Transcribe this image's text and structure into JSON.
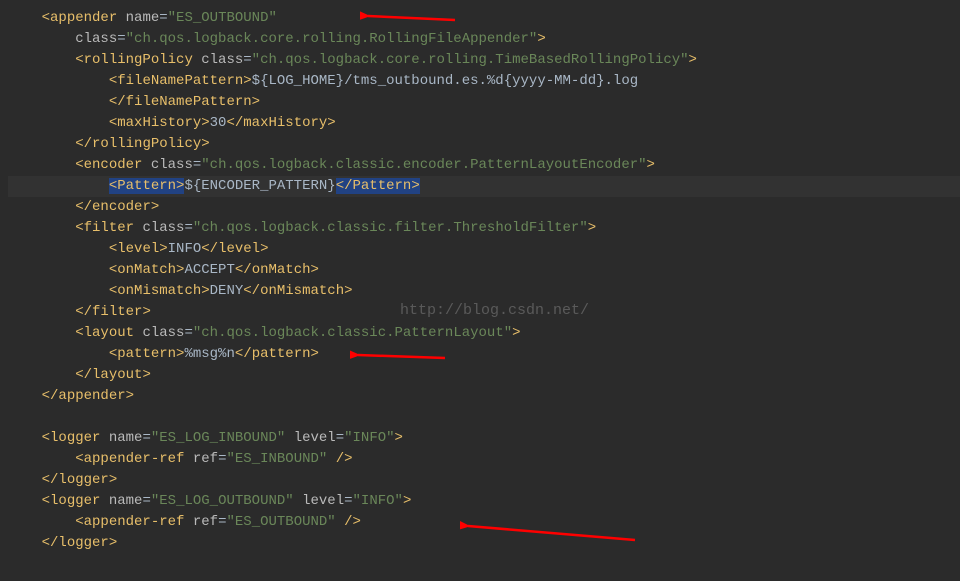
{
  "code": {
    "l1": {
      "indent": "    ",
      "tag": "appender",
      "attr": "name",
      "val": "\"ES_OUTBOUND\""
    },
    "l2": {
      "indent": "        ",
      "attr": "class",
      "val": "\"ch.qos.logback.core.rolling.RollingFileAppender\""
    },
    "l3": {
      "indent": "        ",
      "tag": "rollingPolicy",
      "attr": "class",
      "val": "\"ch.qos.logback.core.rolling.TimeBasedRollingPolicy\""
    },
    "l4": {
      "indent": "            ",
      "tag": "fileNamePattern",
      "txt": "${LOG_HOME}/tms_outbound.es.%d{yyyy-MM-dd}.log"
    },
    "l5": {
      "indent": "            ",
      "close": "fileNamePattern"
    },
    "l6": {
      "indent": "            ",
      "tag": "maxHistory",
      "txt": "30"
    },
    "l7": {
      "indent": "        ",
      "close": "rollingPolicy"
    },
    "l8": {
      "indent": "        ",
      "tag": "encoder",
      "attr": "class",
      "val": "\"ch.qos.logback.classic.encoder.PatternLayoutEncoder\""
    },
    "l9": {
      "indent": "            ",
      "tag": "Pattern",
      "txt": "${ENCODER_PATTERN}"
    },
    "l10": {
      "indent": "        ",
      "close": "encoder"
    },
    "l11": {
      "indent": "        ",
      "tag": "filter",
      "attr": "class",
      "val": "\"ch.qos.logback.classic.filter.ThresholdFilter\""
    },
    "l12": {
      "indent": "            ",
      "tag": "level",
      "txt": "INFO"
    },
    "l13": {
      "indent": "            ",
      "tag": "onMatch",
      "txt": "ACCEPT"
    },
    "l14": {
      "indent": "            ",
      "tag": "onMismatch",
      "txt": "DENY"
    },
    "l15": {
      "indent": "        ",
      "close": "filter"
    },
    "l16": {
      "indent": "        ",
      "tag": "layout",
      "attr": "class",
      "val": "\"ch.qos.logback.classic.PatternLayout\""
    },
    "l17": {
      "indent": "            ",
      "tag": "pattern",
      "txt": "%msg%n"
    },
    "l18": {
      "indent": "        ",
      "close": "layout"
    },
    "l19": {
      "indent": "    ",
      "close": "appender"
    },
    "l20": {
      "indent": ""
    },
    "l21": {
      "indent": "    ",
      "tag": "logger",
      "attr": "name",
      "val": "\"ES_LOG_INBOUND\"",
      "attr2": "level",
      "val2": "\"INFO\""
    },
    "l22": {
      "indent": "        ",
      "tag": "appender-ref",
      "attr": "ref",
      "val": "\"ES_INBOUND\"",
      "self": true
    },
    "l23": {
      "indent": "    ",
      "close": "logger"
    },
    "l24": {
      "indent": "    ",
      "tag": "logger",
      "attr": "name",
      "val": "\"ES_LOG_OUTBOUND\"",
      "attr2": "level",
      "val2": "\"INFO\""
    },
    "l25": {
      "indent": "        ",
      "tag": "appender-ref",
      "attr": "ref",
      "val": "\"ES_OUTBOUND\"",
      "self": true
    },
    "l26": {
      "indent": "    ",
      "close": "logger"
    }
  },
  "watermark": "http://blog.csdn.net/"
}
